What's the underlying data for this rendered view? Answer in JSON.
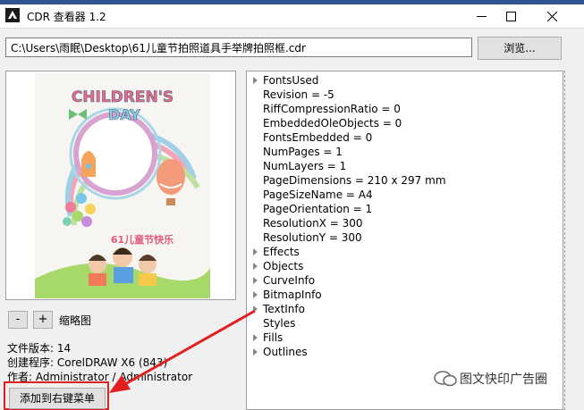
{
  "window": {
    "title": "CDR 查看器 1.2",
    "minimize_icon": "minimize-icon",
    "maximize_icon": "maximize-icon",
    "close_icon": "close-icon"
  },
  "path": {
    "value": "C:\\Users\\雨眠\\Desktop\\61儿童节拍照道具手举牌拍照框.cdr"
  },
  "browse_label": "浏览...",
  "preview": {
    "headline_1": "CHILDREN'S",
    "headline_2": "DAY",
    "subtitle": "61儿童节快乐",
    "zoom_out_label": "-",
    "zoom_in_label": "+",
    "thumbnail_label": "缩略图"
  },
  "file_info": {
    "version": "文件版本: 14",
    "creator": "创建程序: CorelDRAW X6 (843)",
    "author": "作者: Administrator / Administrator"
  },
  "context_menu_button": "添加到右键菜单",
  "tree": [
    {
      "label": "FontsUsed",
      "expandable": true
    },
    {
      "label": "Revision = -5",
      "expandable": false
    },
    {
      "label": "RiffCompressionRatio = 0",
      "expandable": false
    },
    {
      "label": "EmbeddedOleObjects = 0",
      "expandable": false
    },
    {
      "label": "FontsEmbedded = 0",
      "expandable": false
    },
    {
      "label": "NumPages = 1",
      "expandable": false
    },
    {
      "label": "NumLayers = 1",
      "expandable": false
    },
    {
      "label": "PageDimensions = 210 x 297 mm",
      "expandable": false
    },
    {
      "label": "PageSizeName = A4",
      "expandable": false
    },
    {
      "label": "PageOrientation = 1",
      "expandable": false
    },
    {
      "label": "ResolutionX = 300",
      "expandable": false
    },
    {
      "label": "ResolutionY = 300",
      "expandable": false
    },
    {
      "label": "Effects",
      "expandable": true
    },
    {
      "label": "Objects",
      "expandable": true
    },
    {
      "label": "CurveInfo",
      "expandable": true
    },
    {
      "label": "BitmapInfo",
      "expandable": true
    },
    {
      "label": "TextInfo",
      "expandable": true
    },
    {
      "label": "Styles",
      "expandable": false
    },
    {
      "label": "Fills",
      "expandable": true
    },
    {
      "label": "Outlines",
      "expandable": true
    }
  ],
  "watermark": "图文快印广告圈",
  "colors": {
    "annotation": "#e02020",
    "titlebar_accent": "#2f5597"
  }
}
